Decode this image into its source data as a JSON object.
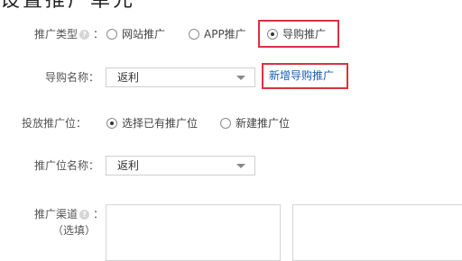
{
  "header": {
    "title_fragment": "设置推广单元"
  },
  "promo_type": {
    "label": "推广类型",
    "options": [
      {
        "label": "网站推广",
        "checked": false
      },
      {
        "label": "APP推广",
        "checked": false
      },
      {
        "label": "导购推广",
        "checked": true
      }
    ]
  },
  "guide_name": {
    "label": "导购名称",
    "selected": "返利",
    "add_link": "新增导购推广"
  },
  "placement": {
    "label": "投放推广位",
    "options": [
      {
        "label": "选择已有推广位",
        "checked": true
      },
      {
        "label": "新建推广位",
        "checked": false
      }
    ]
  },
  "placement_name": {
    "label": "推广位名称",
    "selected": "返利"
  },
  "channel": {
    "label": "推广渠道",
    "note": "（选填）"
  },
  "misc": {
    "colon": "：",
    "help_glyph": "?"
  },
  "colors": {
    "highlight": "#d9323f",
    "link": "#1a5eb5"
  }
}
